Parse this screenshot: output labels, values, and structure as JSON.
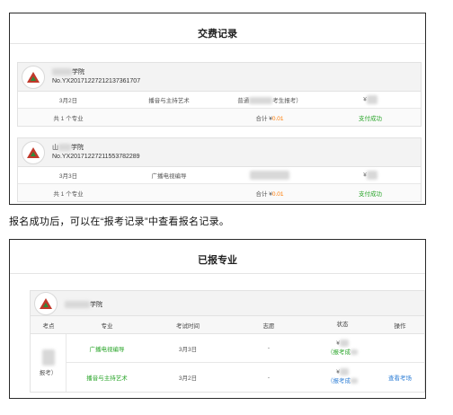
{
  "payment_panel": {
    "title": "交费记录",
    "orders": [
      {
        "school": "学院",
        "order_no": "No.YX20171227212137361707",
        "date": "3月2日",
        "major": "播音与主持艺术",
        "exam_type": "普通",
        "exam_type_suffix": "考生报考）",
        "price_prefix": "¥",
        "summary": "共 1 个专业",
        "total_label": "合计 ¥",
        "total_value": "0.01",
        "status": "支付成功"
      },
      {
        "school": "学院",
        "school_prefix": "山",
        "order_no": "No.YX20171227211553782289",
        "date": "3月3日",
        "major": "广播电视编导",
        "price_prefix": "¥",
        "summary": "共 1 个专业",
        "total_label": "合计 ¥",
        "total_value": "0.01",
        "status": "支付成功"
      }
    ]
  },
  "note": "报名成功后，可以在“报考记录”中查看报名记录。",
  "registered_panel": {
    "title": "已报专业",
    "school": "学院",
    "columns": [
      "考点",
      "专业",
      "考试时间",
      "志愿",
      "状态",
      "操作"
    ],
    "exam_site_suffix": "报考）",
    "rows": [
      {
        "major": "广播电视编导",
        "time": "3月3日",
        "wish": "-",
        "status_prefix": "¥",
        "status_sub": "（报考成",
        "action": ""
      },
      {
        "major": "播音与主持艺术",
        "time": "3月2日",
        "wish": "-",
        "status_prefix": "¥",
        "status_sub": "（报考成",
        "action": "查看考场"
      }
    ]
  }
}
